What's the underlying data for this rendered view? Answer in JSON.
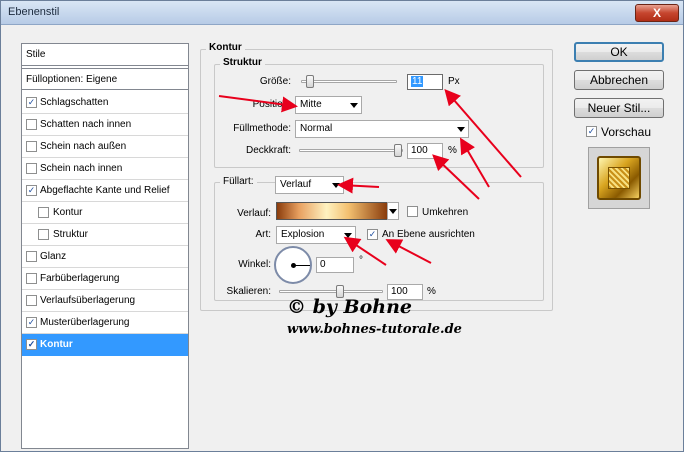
{
  "window": {
    "title": "Ebenenstil",
    "close_symbol": "X"
  },
  "styles_panel": {
    "header": "Stile",
    "blending_options": "Fülloptionen: Eigene",
    "items": [
      {
        "label": "Schlagschatten",
        "checked": true
      },
      {
        "label": "Schatten nach innen",
        "checked": false
      },
      {
        "label": "Schein nach außen",
        "checked": false
      },
      {
        "label": "Schein nach innen",
        "checked": false
      },
      {
        "label": "Abgeflachte Kante und Relief",
        "checked": true
      },
      {
        "label": "Kontur",
        "checked": false,
        "sub": true
      },
      {
        "label": "Struktur",
        "checked": false,
        "sub": true
      },
      {
        "label": "Glanz",
        "checked": false
      },
      {
        "label": "Farbüberlagerung",
        "checked": false
      },
      {
        "label": "Verlaufsüberlagerung",
        "checked": false
      },
      {
        "label": "Musterüberlagerung",
        "checked": true
      },
      {
        "label": "Kontur",
        "checked": true,
        "selected": true
      }
    ]
  },
  "kontur": {
    "title": "Kontur",
    "struktur": {
      "title": "Struktur",
      "size_label": "Größe:",
      "size_value": "11",
      "size_unit": "Px",
      "position_label": "Position:",
      "position_value": "Mitte",
      "blend_mode_label": "Füllmethode:",
      "blend_mode_value": "Normal",
      "opacity_label": "Deckkraft:",
      "opacity_value": "100",
      "opacity_unit": "%"
    },
    "fill": {
      "fill_type_label": "Füllart:",
      "fill_type_value": "Verlauf",
      "gradient_label": "Verlauf:",
      "reverse_label": "Umkehren",
      "reverse_checked": false,
      "style_label": "Art:",
      "style_value": "Explosion",
      "align_label": "An Ebene ausrichten",
      "align_checked": true,
      "angle_label": "Winkel:",
      "angle_value": "0",
      "angle_unit": "°",
      "scale_label": "Skalieren:",
      "scale_value": "100",
      "scale_unit": "%"
    }
  },
  "buttons": {
    "ok": "OK",
    "cancel": "Abbrechen",
    "new_style": "Neuer Stil...",
    "preview_label": "Vorschau",
    "preview_checked": true
  },
  "watermark": {
    "line1": "© by Bohne",
    "line2": "www.bohnes-tutorale.de"
  },
  "colors": {
    "selection": "#3399ff",
    "annotation_arrows": "#e8001c"
  }
}
